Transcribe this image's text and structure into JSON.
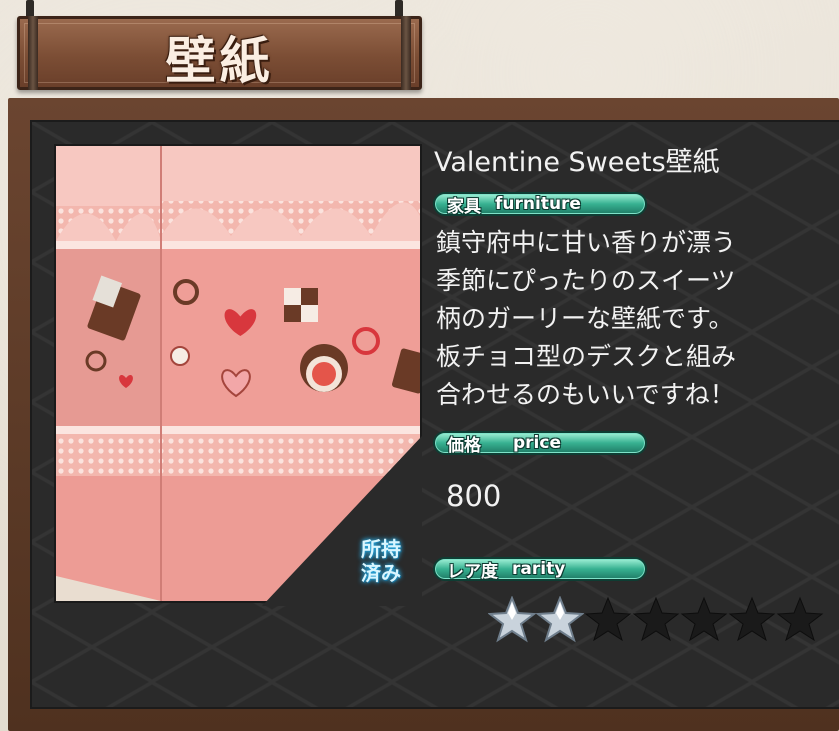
{
  "category_sign": {
    "title": "壁紙"
  },
  "item": {
    "name": "Valentine Sweets壁紙",
    "category": {
      "jp": "家具",
      "en": "furniture"
    },
    "description_lines": [
      "鎮守府中に甘い香りが漂う",
      "季節にぴったりのスイーツ",
      "柄のガーリーな壁紙です。",
      "板チョコ型のデスクと組み",
      "合わせるのもいいですね！"
    ],
    "price_label": {
      "jp": "価格",
      "en": "price"
    },
    "price": "800",
    "owned_label": [
      "所持",
      "済み"
    ],
    "rarity_label": {
      "jp": "レア度",
      "en": "rarity"
    },
    "rarity": {
      "filled": 2,
      "total": 7
    }
  },
  "colors": {
    "badge": "#37b191",
    "wallpaper": "#ec9c95",
    "frame": "#5e3b27",
    "panel": "#2a2a2a",
    "owned_glow": "#2aa9e0"
  },
  "icons": [
    "chocolate-bar-icon",
    "heart-icon",
    "checker-cookie-icon",
    "star-filled-icon",
    "star-empty-icon"
  ]
}
